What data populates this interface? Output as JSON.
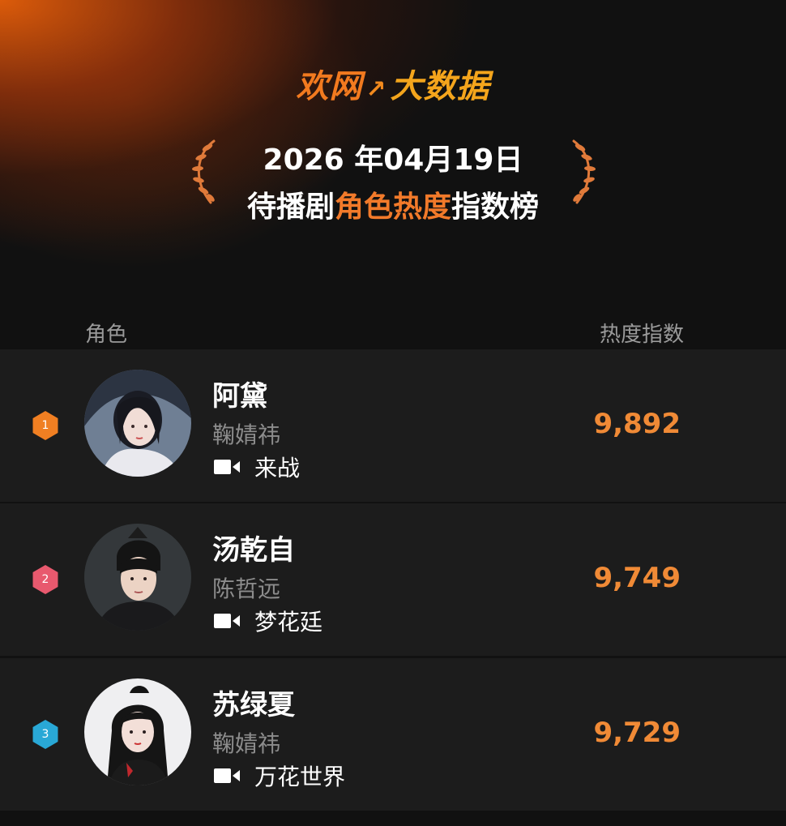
{
  "brand": {
    "part1": "欢网",
    "part2": "大数据"
  },
  "title": {
    "date": "2026 年04月19日",
    "prefix": "待播剧",
    "highlight": "角色热度",
    "suffix": "指数榜"
  },
  "columns": {
    "role": "角色",
    "score": "热度指数"
  },
  "accent_colors": {
    "orange": "#f08a36",
    "rank1": "#f07f22",
    "rank2": "#e8596e",
    "rank3": "#29a8d6"
  },
  "rows": [
    {
      "rank": "1",
      "name": "阿黛",
      "actor": "鞠婧祎",
      "drama": "来战",
      "score": "9,892",
      "icon": "video-camera-icon"
    },
    {
      "rank": "2",
      "name": "汤乾自",
      "actor": "陈哲远",
      "drama": "梦花廷",
      "score": "9,749",
      "icon": "video-camera-icon"
    },
    {
      "rank": "3",
      "name": "苏绿夏",
      "actor": "鞠婧祎",
      "drama": "万花世界",
      "score": "9,729",
      "icon": "video-camera-icon"
    }
  ]
}
